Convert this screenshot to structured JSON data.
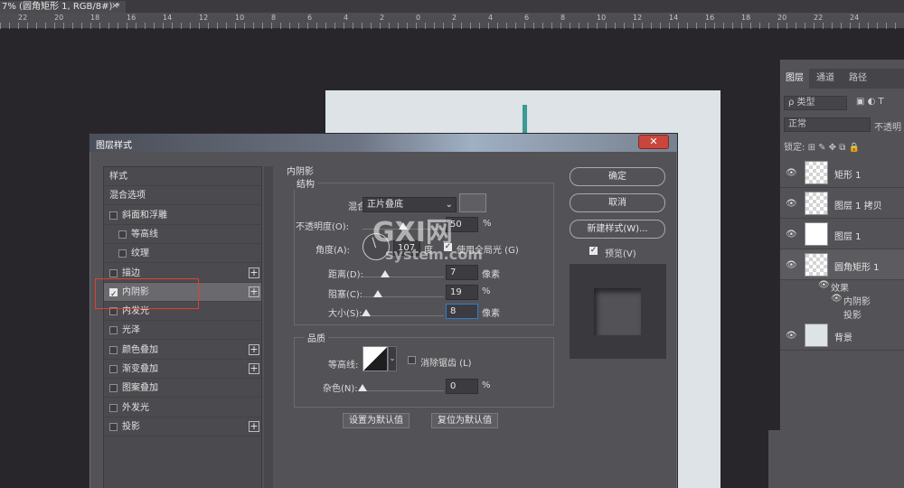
{
  "document_tab": {
    "title": "7% (圆角矩形 1, RGB/8#) *",
    "close": "×"
  },
  "ruler": {
    "numbers": [
      "22",
      "20",
      "18",
      "16",
      "14",
      "12",
      "10",
      "8",
      "6",
      "4",
      "2",
      "0",
      "2",
      "4",
      "6",
      "8",
      "10",
      "12",
      "14",
      "16",
      "18",
      "20",
      "22",
      "24"
    ]
  },
  "dialog": {
    "title": "图层样式",
    "close": "✕",
    "style_list": [
      {
        "label": "样式",
        "checkbox": false,
        "plus": false,
        "checked": false,
        "indent": 0
      },
      {
        "label": "混合选项",
        "checkbox": false,
        "plus": false,
        "checked": false,
        "indent": 0
      },
      {
        "label": "斜面和浮雕",
        "checkbox": true,
        "plus": false,
        "checked": false,
        "indent": 0
      },
      {
        "label": "等高线",
        "checkbox": true,
        "plus": false,
        "checked": false,
        "indent": 1
      },
      {
        "label": "纹理",
        "checkbox": true,
        "plus": false,
        "checked": false,
        "indent": 1
      },
      {
        "label": "描边",
        "checkbox": true,
        "plus": true,
        "checked": false,
        "indent": 0
      },
      {
        "label": "内阴影",
        "checkbox": true,
        "plus": true,
        "checked": true,
        "indent": 0,
        "active": true
      },
      {
        "label": "内发光",
        "checkbox": true,
        "plus": false,
        "checked": false,
        "indent": 0
      },
      {
        "label": "光泽",
        "checkbox": true,
        "plus": false,
        "checked": false,
        "indent": 0
      },
      {
        "label": "颜色叠加",
        "checkbox": true,
        "plus": true,
        "checked": false,
        "indent": 0
      },
      {
        "label": "渐变叠加",
        "checkbox": true,
        "plus": true,
        "checked": false,
        "indent": 0
      },
      {
        "label": "图案叠加",
        "checkbox": true,
        "plus": false,
        "checked": false,
        "indent": 0
      },
      {
        "label": "外发光",
        "checkbox": true,
        "plus": false,
        "checked": false,
        "indent": 0
      },
      {
        "label": "投影",
        "checkbox": true,
        "plus": true,
        "checked": false,
        "indent": 0
      }
    ],
    "inner_shadow": {
      "title": "内阴影",
      "structure": {
        "title": "结构",
        "blend_mode_label": "混合模式:",
        "blend_mode_value": "正片叠底",
        "opacity_label": "不透明度(O):",
        "opacity_value": "50",
        "opacity_fraction": 0.5,
        "unit_percent": "%",
        "angle_label": "角度(A):",
        "angle_value": "107",
        "angle_unit": "度",
        "global_light_label": "使用全局光 (G)",
        "global_light_checked": true,
        "distance_label": "距离(D):",
        "distance_value": "7",
        "distance_fraction": 0.28,
        "unit_px": "像素",
        "choke_label": "阻塞(C):",
        "choke_value": "19",
        "choke_fraction": 0.19,
        "size_label": "大小(S):",
        "size_value": "8",
        "size_fraction": 0.04
      },
      "quality": {
        "title": "品质",
        "contour_label": "等高线:",
        "antialias_label": "消除锯齿 (L)",
        "noise_label": "杂色(N):",
        "noise_value": "0",
        "noise_fraction": 0.0
      },
      "set_default": "设置为默认值",
      "reset_default": "复位为默认值"
    },
    "buttons": {
      "ok": "确定",
      "cancel": "取消",
      "new_style": "新建样式(W)...",
      "preview": "预览(V)",
      "preview_checked": true
    }
  },
  "watermark": {
    "big": "GXI网",
    "small": "system.com"
  },
  "layers_panel": {
    "tabs": [
      "图层",
      "通道",
      "路径"
    ],
    "filter": "ρ 类型",
    "blend": "正常",
    "opacity": "不透明",
    "lock": "锁定:",
    "layers": [
      {
        "name": "矩形 1"
      },
      {
        "name": "图层 1 拷贝"
      },
      {
        "name": "图层 1"
      },
      {
        "name": "圆角矩形 1"
      },
      {
        "name": "背景"
      }
    ],
    "effects": {
      "title": "效果",
      "items": [
        "内阴影",
        "投影"
      ]
    }
  }
}
